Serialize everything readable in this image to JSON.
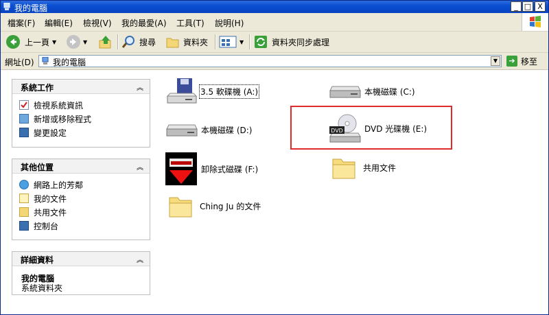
{
  "window": {
    "title": "我的電腦"
  },
  "titlebar_buttons": {
    "minimize": "_",
    "maximize": "□",
    "close": "X"
  },
  "menu": [
    "檔案(F)",
    "編輯(E)",
    "檢視(V)",
    "我的最愛(A)",
    "工具(T)",
    "說明(H)"
  ],
  "toolbar": {
    "back_label": "上一頁",
    "search_label": "搜尋",
    "folders_label": "資料夾",
    "sync_label": "資料夾同步處理"
  },
  "address": {
    "label": "網址(D)",
    "value": "我的電腦",
    "go_label": "移至"
  },
  "panels": {
    "tasks": {
      "title": "系統工作",
      "items": [
        "檢視系統資訊",
        "新增或移除程式",
        "變更設定"
      ]
    },
    "places": {
      "title": "其他位置",
      "items": [
        "網路上的芳鄰",
        "我的文件",
        "共用文件",
        "控制台"
      ]
    },
    "details": {
      "title": "詳細資料",
      "name": "我的電腦",
      "desc": "系統資料夾"
    }
  },
  "items": {
    "floppy": "3.5 軟碟機 (A:)",
    "disk_c": "本機磁碟 (C:)",
    "disk_d": "本機磁碟 (D:)",
    "dvd": "DVD 光碟機 (E:)",
    "removable": "卸除式磁碟 (F:)",
    "shared": "共用文件",
    "user_docs": "Ching Ju 的文件"
  },
  "dvd_badge": "DVD",
  "colors": {
    "titlebar": "#0a4fd2",
    "highlight_box": "#e02b2b",
    "panel_bg": "#f2f2f2"
  },
  "icons": [
    "computer-icon",
    "back-arrow-icon",
    "forward-arrow-icon",
    "up-folder-icon",
    "search-icon",
    "folders-icon",
    "views-icon",
    "sync-icon",
    "windows-logo-icon"
  ]
}
